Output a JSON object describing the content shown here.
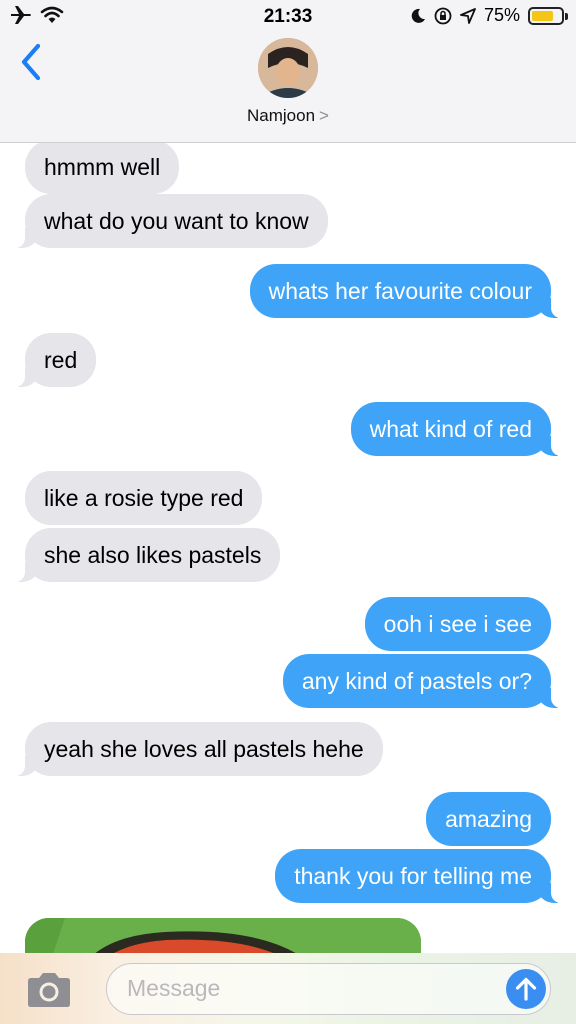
{
  "status_bar": {
    "time": "21:33",
    "battery_percent": "75%",
    "battery_level": 0.75,
    "battery_color": "#f5c518",
    "icons": [
      "airplane-icon",
      "wifi-icon",
      "moon-icon",
      "rotation-lock-icon",
      "location-icon",
      "battery-icon"
    ]
  },
  "header": {
    "contact_name": "Namjoon",
    "contact_chevron": ">",
    "back_icon": "chevron-left-icon"
  },
  "messages": [
    {
      "from": "them",
      "text": "hmmm well"
    },
    {
      "from": "them",
      "text": "what do you want to know"
    },
    {
      "from": "me",
      "text": "whats her favourite colour"
    },
    {
      "from": "them",
      "text": "red"
    },
    {
      "from": "me",
      "text": "what kind of red"
    },
    {
      "from": "them",
      "text": "like a rosie type red"
    },
    {
      "from": "them",
      "text": "she also likes pastels"
    },
    {
      "from": "me",
      "text": "ooh i see i see"
    },
    {
      "from": "me",
      "text": "any kind of pastels or?"
    },
    {
      "from": "them",
      "text": "yeah she loves all pastels hehe"
    },
    {
      "from": "me",
      "text": "amazing"
    },
    {
      "from": "me",
      "text": "thank you for telling me"
    }
  ],
  "composer": {
    "placeholder": "Message",
    "value": "",
    "camera_icon": "camera-icon",
    "send_icon": "arrow-up-icon"
  },
  "colors": {
    "outgoing_bubble": "#3fa4f7",
    "incoming_bubble": "#e5e5ea",
    "accent": "#3a8ef2"
  }
}
